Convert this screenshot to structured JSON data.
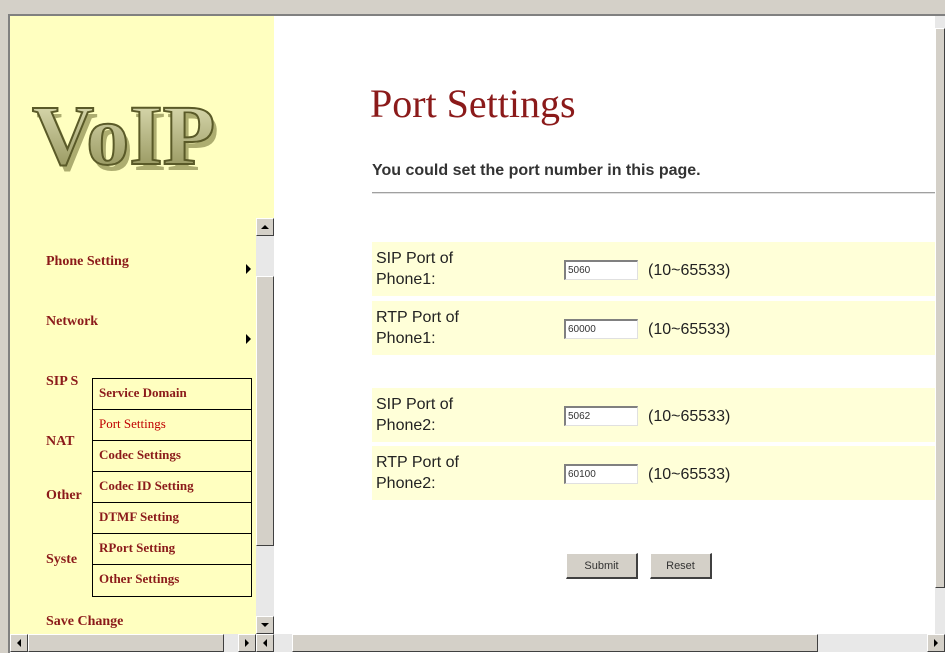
{
  "logo": {
    "text": "VoIP"
  },
  "menu": {
    "items": [
      {
        "label": "Phone Setting",
        "has_submenu": true
      },
      {
        "label": "Network",
        "has_submenu": true
      },
      {
        "label": "SIP S",
        "has_submenu": false
      },
      {
        "label": "NAT",
        "has_submenu": false
      },
      {
        "label": "Other",
        "has_submenu": false
      },
      {
        "label": "Syste",
        "has_submenu": false
      },
      {
        "label": "Save Change",
        "has_submenu": false
      }
    ],
    "submenu": [
      {
        "label": "Service Domain",
        "active": false
      },
      {
        "label": "Port Settings",
        "active": true
      },
      {
        "label": "Codec Settings",
        "active": false
      },
      {
        "label": "Codec ID Setting",
        "active": false
      },
      {
        "label": "DTMF Setting",
        "active": false
      },
      {
        "label": "RPort Setting",
        "active": false
      },
      {
        "label": "Other Settings",
        "active": false
      }
    ]
  },
  "page": {
    "title": "Port Settings",
    "description": "You could set the port number in this page.",
    "rows": [
      {
        "label_line1": "SIP Port of",
        "label_line2": "Phone1:",
        "value": "5060",
        "range": "(10~65533)"
      },
      {
        "label_line1": "RTP Port of",
        "label_line2": "Phone1:",
        "value": "60000",
        "range": "(10~65533)"
      },
      {
        "label_line1": "SIP Port of",
        "label_line2": "Phone2:",
        "value": "5062",
        "range": "(10~65533)"
      },
      {
        "label_line1": "RTP Port of",
        "label_line2": "Phone2:",
        "value": "60100",
        "range": "(10~65533)"
      }
    ],
    "submit_label": "Submit",
    "reset_label": "Reset"
  },
  "colors": {
    "menu_background": "#ffffc0",
    "menu_text": "#8b1a1a",
    "title_color": "#8b1a1a",
    "row_background": "#ffffd8"
  }
}
